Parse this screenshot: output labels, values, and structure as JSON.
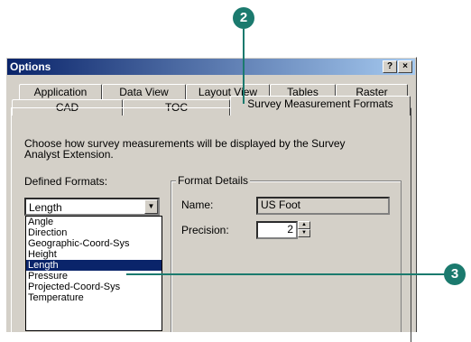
{
  "dialog": {
    "title": "Options",
    "help_btn": "?",
    "close_btn": "×"
  },
  "tabs_row1": [
    "Application",
    "Data View",
    "Layout View",
    "Tables",
    "Raster"
  ],
  "tabs_row2": [
    "CAD",
    "TOC",
    "Survey Measurement Formats"
  ],
  "active_tab": "Survey Measurement Formats",
  "description": "Choose how survey measurements will be displayed by the Survey Analyst Extension.",
  "defined_formats": {
    "label": "Defined Formats:",
    "selected": "Length",
    "options": [
      "Angle",
      "Direction",
      "Geographic-Coord-Sys",
      "Height",
      "Length",
      "Pressure",
      "Projected-Coord-Sys",
      "Temperature"
    ],
    "highlighted": "Length"
  },
  "format_details": {
    "title": "Format Details",
    "name_label": "Name:",
    "name_value": "US Foot",
    "precision_label": "Precision:",
    "precision_value": "2"
  },
  "callouts": [
    "2",
    "3"
  ],
  "colors": {
    "callout": "#1b7a6e",
    "selection": "#0a246a",
    "title_bar": "#0a246a"
  }
}
